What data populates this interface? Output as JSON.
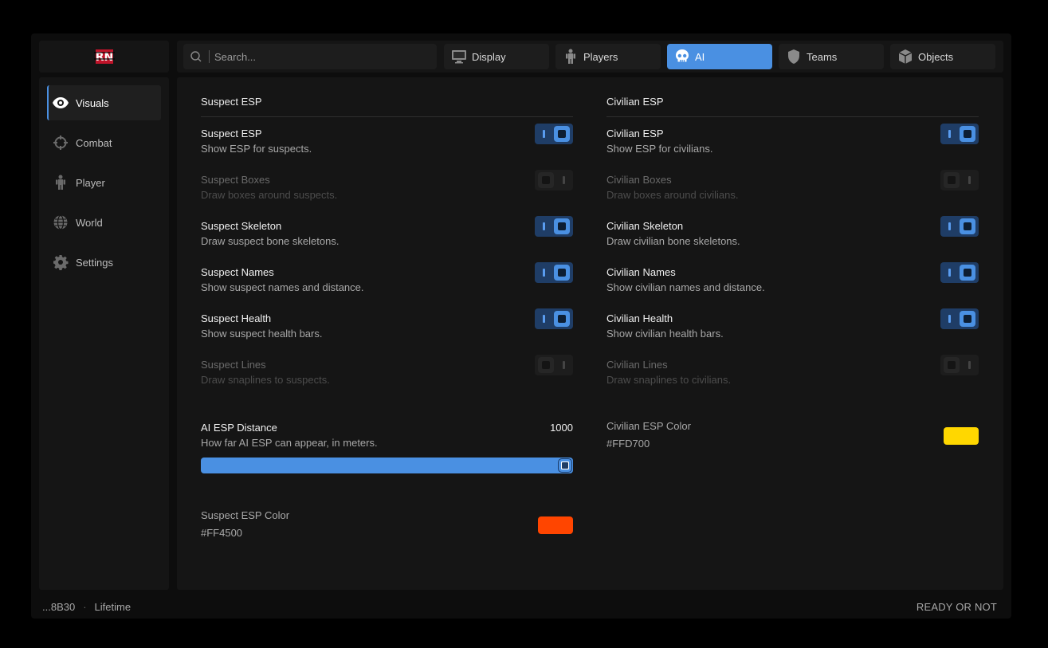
{
  "app": {
    "logo_text": "RN"
  },
  "search": {
    "placeholder": "Search..."
  },
  "tabs": [
    {
      "label": "Display",
      "icon": "monitor-icon"
    },
    {
      "label": "Players",
      "icon": "person-icon"
    },
    {
      "label": "AI",
      "icon": "skull-icon",
      "active": true
    },
    {
      "label": "Teams",
      "icon": "shield-icon"
    },
    {
      "label": "Objects",
      "icon": "cube-icon"
    }
  ],
  "sidebar": {
    "items": [
      {
        "label": "Visuals",
        "icon": "eye-icon",
        "active": true
      },
      {
        "label": "Combat",
        "icon": "crosshair-icon"
      },
      {
        "label": "Player",
        "icon": "person-icon"
      },
      {
        "label": "World",
        "icon": "globe-icon"
      },
      {
        "label": "Settings",
        "icon": "gear-icon"
      }
    ]
  },
  "suspect": {
    "section_title": "Suspect ESP",
    "rows": [
      {
        "title": "Suspect ESP",
        "desc": "Show ESP for suspects.",
        "enabled": true
      },
      {
        "title": "Suspect Boxes",
        "desc": "Draw boxes around suspects.",
        "enabled": false
      },
      {
        "title": "Suspect Skeleton",
        "desc": "Draw suspect bone skeletons.",
        "enabled": true
      },
      {
        "title": "Suspect Names",
        "desc": "Show suspect names and distance.",
        "enabled": true
      },
      {
        "title": "Suspect Health",
        "desc": "Show suspect health bars.",
        "enabled": true
      },
      {
        "title": "Suspect Lines",
        "desc": "Draw snaplines to suspects.",
        "enabled": false
      }
    ],
    "slider": {
      "title": "AI ESP Distance",
      "desc": "How far AI ESP can appear, in meters.",
      "value": "1000",
      "fill_percent": 100
    },
    "color": {
      "title": "Suspect ESP Color",
      "hex": "#FF4500",
      "value": "#FF4500"
    }
  },
  "civilian": {
    "section_title": "Civilian ESP",
    "rows": [
      {
        "title": "Civilian ESP",
        "desc": "Show ESP for civilians.",
        "enabled": true
      },
      {
        "title": "Civilian Boxes",
        "desc": "Draw boxes around civilians.",
        "enabled": false
      },
      {
        "title": "Civilian Skeleton",
        "desc": "Draw civilian bone skeletons.",
        "enabled": true
      },
      {
        "title": "Civilian Names",
        "desc": "Show civilian names and distance.",
        "enabled": true
      },
      {
        "title": "Civilian Health",
        "desc": "Show civilian health bars.",
        "enabled": true
      },
      {
        "title": "Civilian Lines",
        "desc": "Draw snaplines to civilians.",
        "enabled": false
      }
    ],
    "color": {
      "title": "Civilian ESP Color",
      "hex": "#FFD700",
      "value": "#FFD700"
    }
  },
  "status": {
    "key": "...8B30",
    "separator": "·",
    "license": "Lifetime",
    "game": "READY OR NOT"
  },
  "colors": {
    "accent": "#4a90e2",
    "background": "#0d0d0d",
    "panel": "#151515"
  }
}
